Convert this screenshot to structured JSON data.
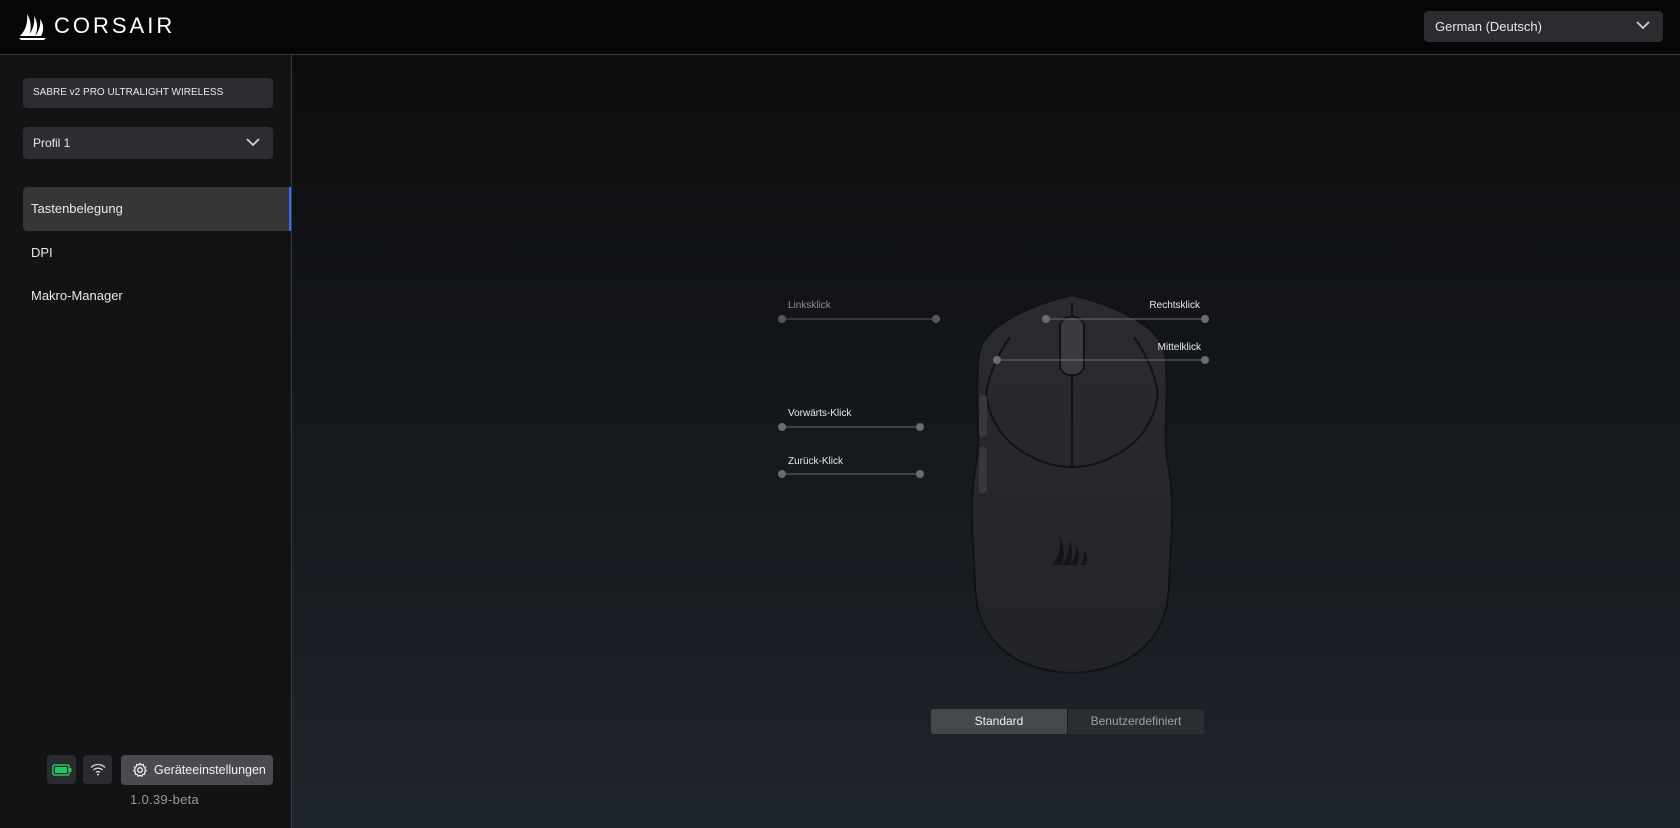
{
  "header": {
    "brand": "CORSAIR",
    "language_select": "German (Deutsch)"
  },
  "sidebar": {
    "device_name": "SABRE v2 PRO ULTRALIGHT WIRELESS",
    "profile_select": "Profil 1",
    "nav": [
      {
        "label": "Tastenbelegung",
        "active": true
      },
      {
        "label": "DPI",
        "active": false
      },
      {
        "label": "Makro-Manager",
        "active": false
      }
    ],
    "settings_label": "Geräteeinstellungen",
    "version": "1.0.39-beta",
    "battery_color": "#22c55e"
  },
  "mouse": {
    "callouts": {
      "left_click": "Linksklick",
      "right_click": "Rechtsklick",
      "middle_click": "Mittelklick",
      "forward_click": "Vorwärts-Klick",
      "back_click": "Zurück-Klick"
    }
  },
  "mode_toggle": {
    "standard": "Standard",
    "custom": "Benutzerdefiniert",
    "selected": "Standard"
  },
  "colors": {
    "accent": "#3f63ff"
  }
}
